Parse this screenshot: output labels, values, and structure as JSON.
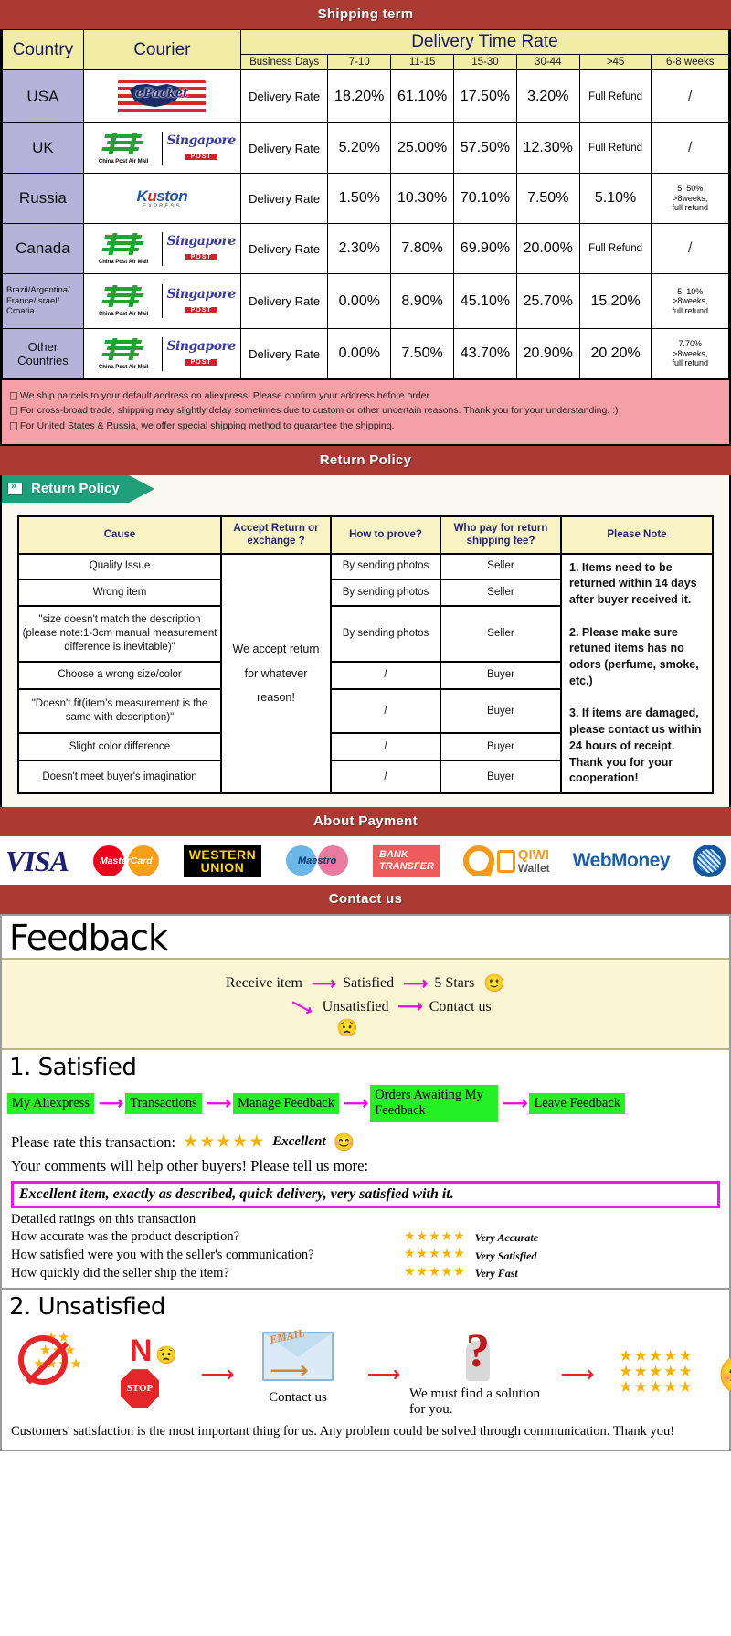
{
  "banners": {
    "shipping": "Shipping term",
    "return": "Return Policy",
    "payment": "About Payment",
    "contact": "Contact us"
  },
  "shipping_table": {
    "col_country": "Country",
    "col_courier": "Courier",
    "col_delivery_time_rate": "Delivery Time Rate",
    "sub_headers": [
      "Business Days",
      "7-10",
      "11-15",
      "15-30",
      "30-44",
      ">45",
      "6-8 weeks"
    ],
    "rows": [
      {
        "country": "USA",
        "couriers": [
          "ePacket"
        ],
        "label": "Delivery Rate",
        "values": [
          "18.20%",
          "61.10%",
          "17.50%",
          "3.20%",
          "Full Refund",
          "/"
        ]
      },
      {
        "country": "UK",
        "couriers": [
          "China Post Air Mail",
          "Singapore POST"
        ],
        "label": "Delivery Rate",
        "values": [
          "5.20%",
          "25.00%",
          "57.50%",
          "12.30%",
          "Full Refund",
          "/"
        ]
      },
      {
        "country": "Russia",
        "couriers": [
          "Kuston EXPRESS"
        ],
        "label": "Delivery Rate",
        "values": [
          "1.50%",
          "10.30%",
          "70.10%",
          "7.50%",
          "5.10%",
          "5. 50%\n>8weeks,\nfull refund"
        ]
      },
      {
        "country": "Canada",
        "couriers": [
          "China Post Air Mail",
          "Singapore POST"
        ],
        "label": "Delivery Rate",
        "values": [
          "2.30%",
          "7.80%",
          "69.90%",
          "20.00%",
          "Full Refund",
          "/"
        ]
      },
      {
        "country": "Brazil/Argentina/\nFrance/Israel/\nCroatia",
        "couriers": [
          "China Post Air Mail",
          "Singapore POST"
        ],
        "label": "Delivery Rate",
        "values": [
          "0.00%",
          "8.90%",
          "45.10%",
          "25.70%",
          "15.20%",
          "5. 10%\n>8weeks,\nfull refund"
        ]
      },
      {
        "country": "Other Countries",
        "couriers": [
          "China Post Air Mail",
          "Singapore POST"
        ],
        "label": "Delivery Rate",
        "values": [
          "0.00%",
          "7.50%",
          "43.70%",
          "20.90%",
          "20.20%",
          "7.70%\n>8weeks,\nfull refund"
        ]
      }
    ],
    "notes": [
      "We ship parcels to your default address on aliexpress. Please confirm your address before order.",
      "For cross-broad trade, shipping may slightly delay sometimes due to custom or other uncertain reasons. Thank you for your understanding. :)",
      "For United States & Russia, we offer special shipping method to guarantee the shipping."
    ]
  },
  "return_policy": {
    "tab_label": "Return Policy",
    "headers": [
      "Cause",
      "Accept Return or exchange ?",
      "How to prove?",
      "Who pay for return shipping fee?",
      "Please Note"
    ],
    "accept_text": "We accept return for whatever reason!",
    "rows": [
      {
        "cause": "Quality Issue",
        "prove": "By sending photos",
        "pays": "Seller"
      },
      {
        "cause": "Wrong item",
        "prove": "By sending photos",
        "pays": "Seller"
      },
      {
        "cause": "\"size doesn't match the description (please note:1-3cm manual measurement difference is inevitable)\"",
        "prove": "By sending photos",
        "pays": "Seller"
      },
      {
        "cause": "Choose a wrong size/color",
        "prove": "/",
        "pays": "Buyer"
      },
      {
        "cause": "\"Doesn't fit(item's measurement is the same with description)\"",
        "prove": "/",
        "pays": "Buyer"
      },
      {
        "cause": "Slight color difference",
        "prove": "/",
        "pays": "Buyer"
      },
      {
        "cause": "Doesn't meet buyer's imagination",
        "prove": "/",
        "pays": "Buyer"
      }
    ],
    "notes": [
      "1. Items need to be returned within 14 days after buyer received it.",
      "2. Please make sure retuned items has no odors (perfume, smoke, etc.)",
      "3. If items are damaged, please contact us within 24 hours of receipt.",
      "Thank you for your cooperation!"
    ]
  },
  "payment_methods": [
    {
      "name": "VISA",
      "icon": "visa-logo"
    },
    {
      "name": "MasterCard",
      "icon": "mastercard-logo"
    },
    {
      "name": "WESTERN UNION",
      "line1": "WESTERN",
      "line2": "UNION",
      "icon": "western-union-logo"
    },
    {
      "name": "Maestro",
      "icon": "maestro-logo"
    },
    {
      "name": "BANK TRANSFER",
      "line1": "BANK",
      "line2": "TRANSFER",
      "icon": "bank-transfer-logo"
    },
    {
      "name": "QIWI Wallet",
      "line1": "QIWI",
      "line2": "Wallet",
      "icon": "qiwi-wallet-logo"
    },
    {
      "name": "WebMoney",
      "icon": "webmoney-logo"
    }
  ],
  "feedback": {
    "title": "Feedback",
    "flow": {
      "receive": "Receive item",
      "satisfied": "Satisfied",
      "five_stars": "5 Stars",
      "unsatisfied": "Unsatisfied",
      "contact_us": "Contact us",
      "happy_face": "🙂",
      "sad_face": "😟"
    },
    "satisfied": {
      "heading": "1. Satisfied",
      "steps": [
        "My Aliexpress",
        "Transactions",
        "Manage Feedback",
        "Orders Awaiting My Feedback",
        "Leave Feedback"
      ],
      "rate_label": "Please rate this transaction:",
      "stars": "★★★★★",
      "rate_word": "Excellent",
      "rate_face": "😊",
      "comments_label": "Your comments will help other buyers! Please tell us more:",
      "comment_text": "Excellent item, exactly as described, quick delivery, very satisfied with it.",
      "detail_heading": "Detailed ratings on this transaction",
      "detail_rows": [
        {
          "question": "How accurate was the product description?",
          "stars": "★★★★★",
          "value": "Very Accurate"
        },
        {
          "question": "How satisfied were you with the seller's communication?",
          "stars": "★★★★★",
          "value": "Very Satisfied"
        },
        {
          "question": "How quickly did the seller ship the item?",
          "stars": "★★★★★",
          "value": "Very Fast"
        }
      ]
    },
    "unsatisfied": {
      "heading": "2. Unsatisfied",
      "no_text": "N",
      "stop_text": "STOP",
      "email_text": "EMAIL",
      "contact_caption": "Contact us",
      "solution_caption": "We must find a solution for you.",
      "closing": "Customers' satisfaction is the most important thing for us. Any problem could be solved through communication. Thank you!"
    }
  },
  "colors": {
    "banner_red": "#ab3a35",
    "header_yellow": "#f2eda6",
    "country_purple": "#b6b2da",
    "note_pink": "#f4a0a6",
    "return_tab_green": "#1f9e7a",
    "step_green": "#24f024",
    "magenta": "#ea18ea",
    "star_gold": "#f5b301"
  }
}
